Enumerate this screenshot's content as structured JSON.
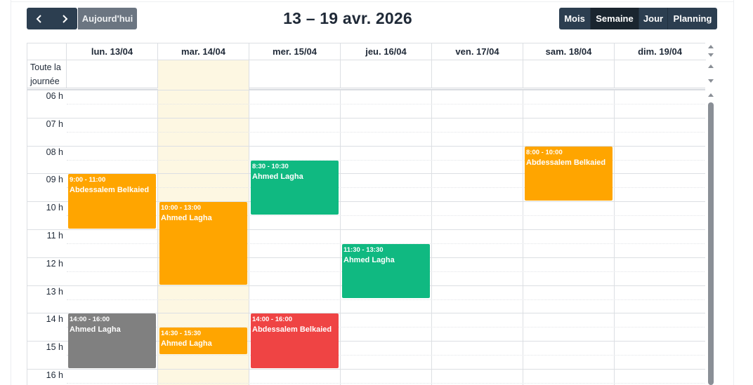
{
  "toolbar": {
    "prev_icon": "chevron-left-icon",
    "next_icon": "chevron-right-icon",
    "today_label": "Aujourd'hui",
    "title": "13 – 19 avr. 2026",
    "views": [
      "Mois",
      "Semaine",
      "Jour",
      "Planning"
    ],
    "active_view": "Semaine"
  },
  "calendar": {
    "allday_label": "Toute la journée",
    "days": [
      "lun. 13/04",
      "mar. 14/04",
      "mer. 15/04",
      "jeu. 16/04",
      "ven. 17/04",
      "sam. 18/04",
      "dim. 19/04"
    ],
    "today_index": 1,
    "hours": [
      "06 h",
      "07 h",
      "08 h",
      "09 h",
      "10 h",
      "11 h",
      "12 h",
      "13 h",
      "14 h",
      "15 h",
      "16 h"
    ],
    "events": [
      {
        "day": 0,
        "start": 9,
        "end": 11,
        "time": "9:00 - 11:00",
        "title": "Abdessalem Belkaied",
        "color": "#ffa500"
      },
      {
        "day": 0,
        "start": 14,
        "end": 16,
        "time": "14:00 - 16:00",
        "title": "Ahmed Lagha",
        "color": "#808080"
      },
      {
        "day": 1,
        "start": 10,
        "end": 13,
        "time": "10:00 - 13:00",
        "title": "Ahmed Lagha",
        "color": "#ffa500"
      },
      {
        "day": 1,
        "start": 14.5,
        "end": 15.5,
        "time": "14:30 - 15:30",
        "title": "Ahmed Lagha",
        "color": "#ffa500"
      },
      {
        "day": 2,
        "start": 8.5,
        "end": 10.5,
        "time": "8:30 - 10:30",
        "title": "Ahmed Lagha",
        "color": "#10b981"
      },
      {
        "day": 2,
        "start": 14,
        "end": 16,
        "time": "14:00 - 16:00",
        "title": "Abdessalem Belkaied",
        "color": "#ef4444"
      },
      {
        "day": 3,
        "start": 11.5,
        "end": 13.5,
        "time": "11:30 - 13:30",
        "title": "Ahmed Lagha",
        "color": "#10b981"
      },
      {
        "day": 5,
        "start": 8,
        "end": 10,
        "time": "8:00 - 10:00",
        "title": "Abdessalem Belkaied",
        "color": "#ffa500"
      }
    ]
  },
  "colors": {
    "toolbar_bg": "#2c3e50",
    "toolbar_active": "#1a252f",
    "today_btn": "#6b7581",
    "today_column": "#fdf7e2"
  }
}
